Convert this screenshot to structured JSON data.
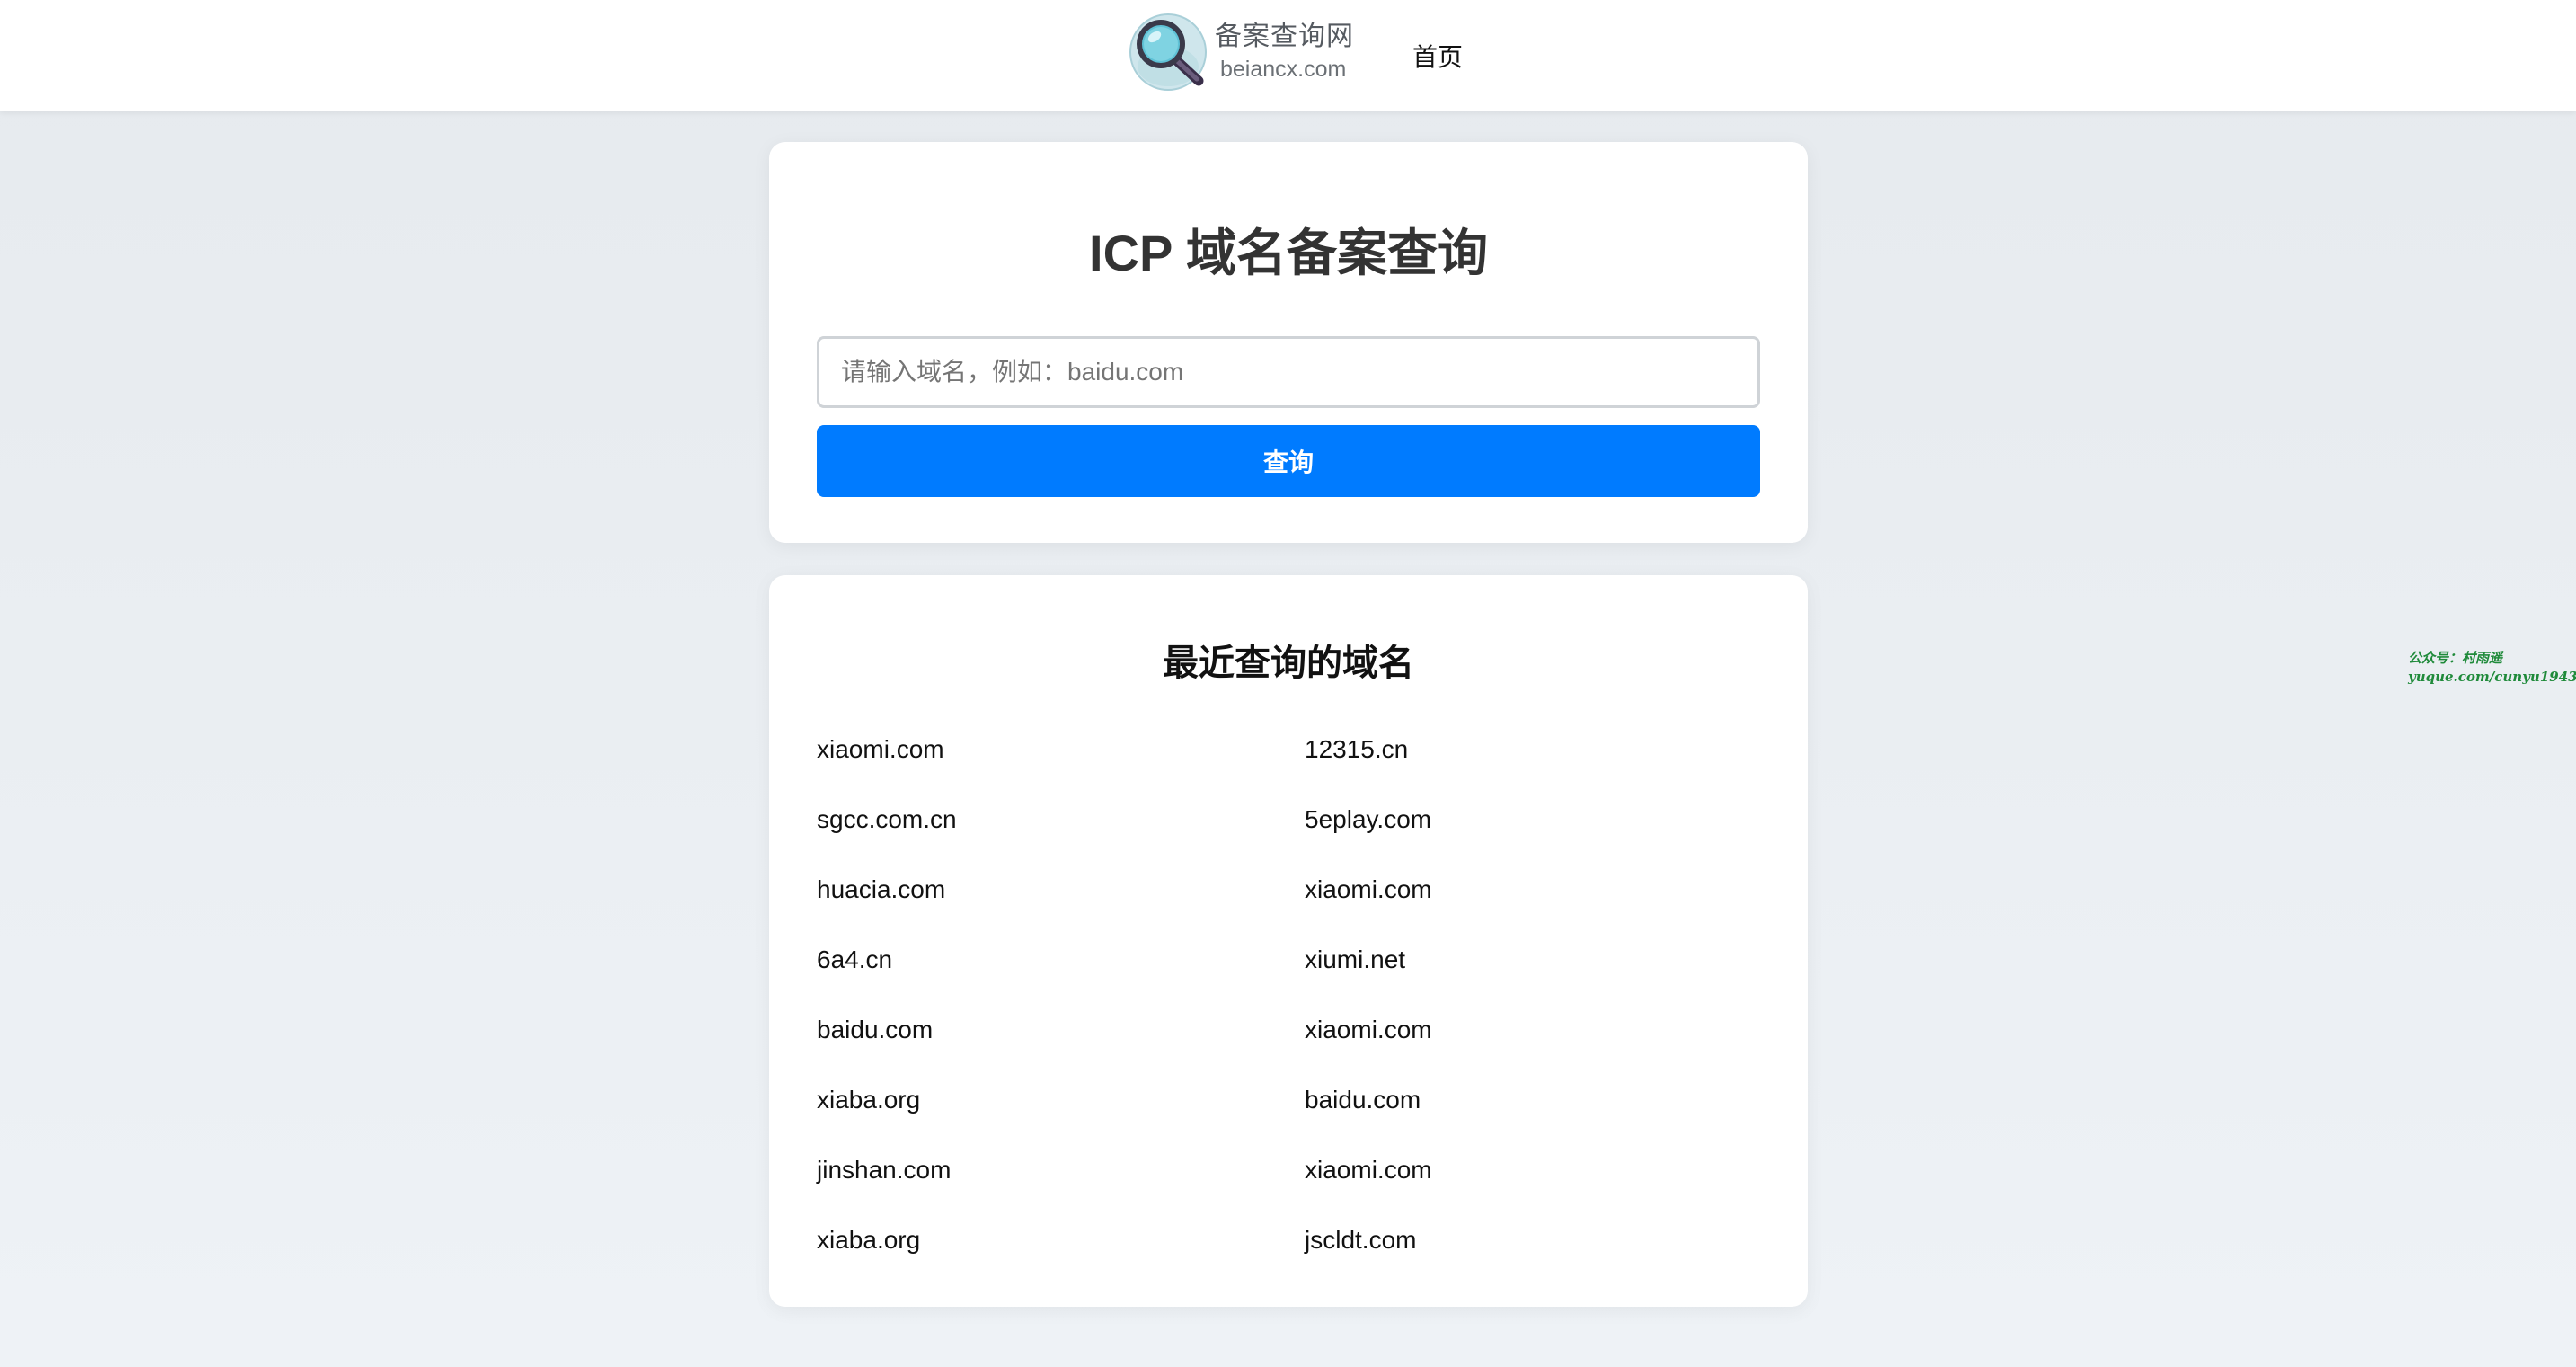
{
  "header": {
    "logo_title": "备案查询网",
    "logo_subtitle": "beiancx.com",
    "nav_home": "首页"
  },
  "search": {
    "title": "ICP 域名备案查询",
    "placeholder": "请输入域名，例如：baidu.com",
    "button_label": "查询"
  },
  "recent": {
    "title": "最近查询的域名",
    "items": [
      "xiaomi.com",
      "12315.cn",
      "sgcc.com.cn",
      "5eplay.com",
      "huacia.com",
      "xiaomi.com",
      "6a4.cn",
      "xiumi.net",
      "baidu.com",
      "xiaomi.com",
      "xiaba.org",
      "baidu.com",
      "jinshan.com",
      "xiaomi.com",
      "xiaba.org",
      "jscldt.com"
    ]
  },
  "watermark": {
    "line1": "公众号：村雨遥",
    "line2": "yuque.com/cunyu1943"
  },
  "colors": {
    "primary": "#007bff",
    "page_background": "#eef2f6",
    "card_background": "#ffffff",
    "watermark": "#1f8a3a"
  },
  "icons": {
    "logo": "magnifier-icon"
  }
}
